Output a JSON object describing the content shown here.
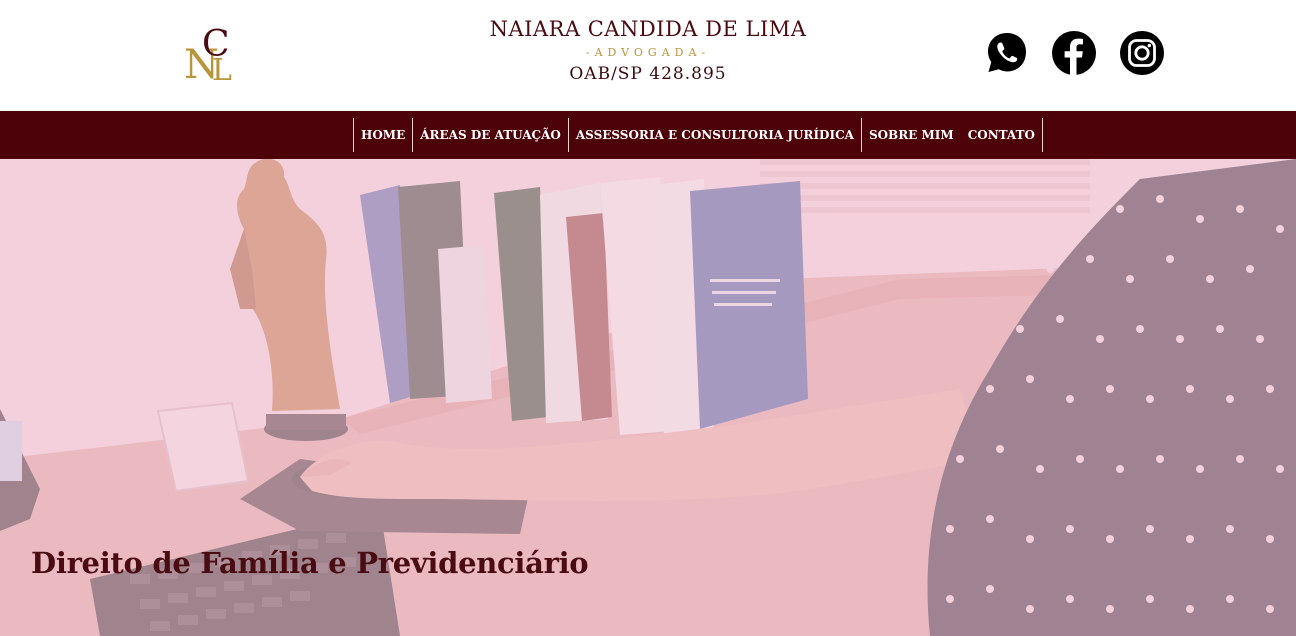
{
  "header": {
    "logo": {
      "letters": "NCL",
      "icon": "ncl-monogram-logo"
    },
    "name": "NAIARA CANDIDA DE LIMA",
    "role": "-ADVOGADA-",
    "oab": "OAB/SP 428.895"
  },
  "socials": [
    {
      "icon": "whatsapp-icon",
      "label": "WhatsApp"
    },
    {
      "icon": "facebook-icon",
      "label": "Facebook"
    },
    {
      "icon": "instagram-icon",
      "label": "Instagram"
    }
  ],
  "nav": {
    "items": [
      {
        "label": "HOME"
      },
      {
        "label": "ÁREAS DE ATUAÇÃO"
      },
      {
        "label": "ASSESSORIA E CONSULTORIA JURÍDICA"
      },
      {
        "label": "SOBRE MIM"
      },
      {
        "label": "CONTATO"
      }
    ]
  },
  "hero": {
    "title": "Direito de Família e Previdenciário",
    "image": "office-desk-books-justice-statue-photo"
  },
  "colors": {
    "brand": "#4c0208",
    "gold": "#b8943a",
    "overlay": "#f2c8d6"
  }
}
